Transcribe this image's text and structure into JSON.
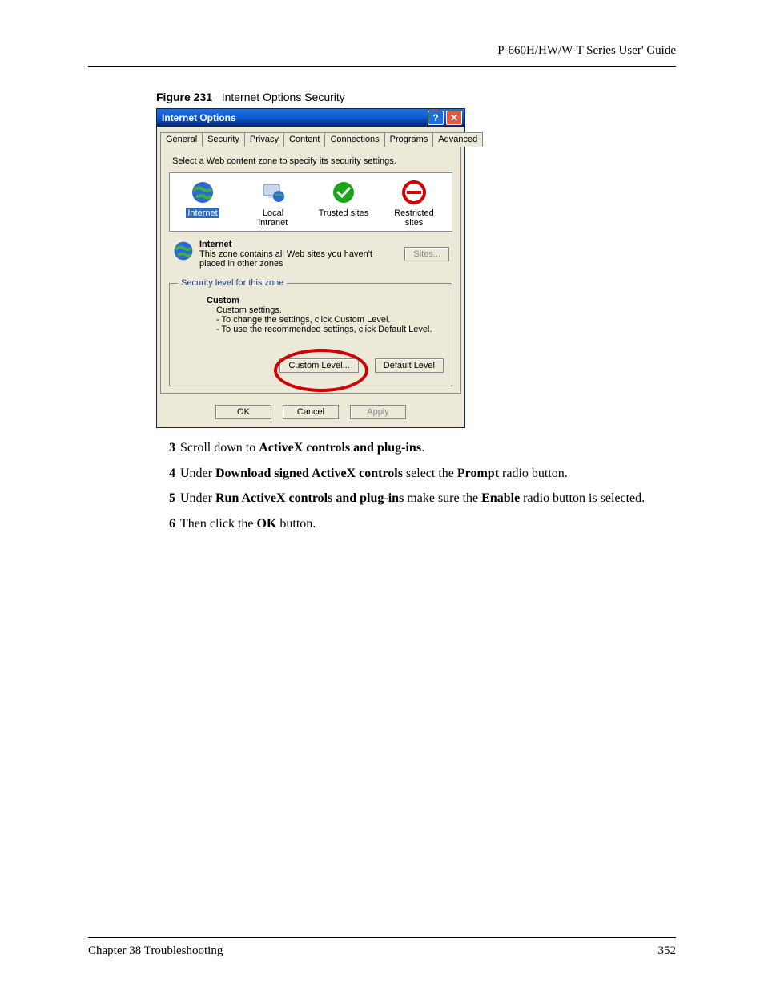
{
  "header": {
    "right": "P-660H/HW/W-T Series User' Guide"
  },
  "figure": {
    "label": "Figure 231",
    "title": "Internet Options Security"
  },
  "dialog": {
    "title": "Internet Options",
    "help": "?",
    "close": "✕",
    "tabs": [
      "General",
      "Security",
      "Privacy",
      "Content",
      "Connections",
      "Programs",
      "Advanced"
    ],
    "active_tab_index": 1,
    "prompt": "Select a Web content zone to specify its security settings.",
    "zones": [
      {
        "name": "Internet",
        "selected": true
      },
      {
        "name": "Local intranet",
        "selected": false
      },
      {
        "name": "Trusted sites",
        "selected": false
      },
      {
        "name": "Restricted sites",
        "selected": false
      }
    ],
    "zone_desc": {
      "heading": "Internet",
      "text": "This zone contains all Web sites you haven't placed in other zones",
      "sites_button": "Sites..."
    },
    "security_level": {
      "legend": "Security level for this zone",
      "heading": "Custom",
      "sub": "Custom settings.",
      "line1": "- To change the settings, click Custom Level.",
      "line2": "- To use the recommended settings, click Default Level.",
      "custom_button": "Custom Level...",
      "default_button": "Default Level"
    },
    "buttons": {
      "ok": "OK",
      "cancel": "Cancel",
      "apply": "Apply"
    }
  },
  "steps": [
    {
      "n": "3",
      "pre": "Scroll down to ",
      "b1": "ActiveX controls and plug-ins",
      "post": "."
    },
    {
      "n": "4",
      "pre": "Under ",
      "b1": "Download signed ActiveX controls",
      "mid": " select the ",
      "b2": "Prompt",
      "post": " radio button."
    },
    {
      "n": "5",
      "pre": "Under ",
      "b1": "Run ActiveX controls and plug-ins",
      "mid": " make sure the ",
      "b2": "Enable",
      "post": " radio button is selected."
    },
    {
      "n": "6",
      "pre": "Then click the ",
      "b1": "OK",
      "post": " button."
    }
  ],
  "footer": {
    "left": "Chapter 38 Troubleshooting",
    "right": "352"
  }
}
